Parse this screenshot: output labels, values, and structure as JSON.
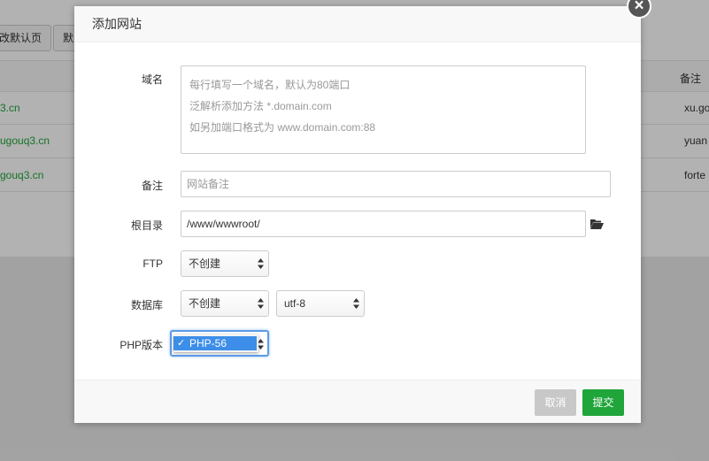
{
  "background": {
    "buttons": [
      "改默认页",
      "默"
    ],
    "column_header": "备注",
    "rows": [
      {
        "domain": "3.cn",
        "note": "xu.go"
      },
      {
        "domain": "ugouq3.cn",
        "note": "yuan"
      },
      {
        "domain": "gouq3.cn",
        "note": "forte"
      }
    ]
  },
  "dialog": {
    "title": "添加网站",
    "close_label": "×",
    "fields": {
      "domain": {
        "label": "域名",
        "placeholder_lines": [
          "每行填写一个域名，默认为80端口",
          "泛解析添加方法 *.domain.com",
          "如另加端口格式为 www.domain.com:88"
        ]
      },
      "note": {
        "label": "备注",
        "placeholder": "网站备注"
      },
      "root": {
        "label": "根目录",
        "value": "/www/wwwroot/"
      },
      "ftp": {
        "label": "FTP",
        "selected": "不创建"
      },
      "database": {
        "label": "数据库",
        "selected": "不创建",
        "charset": "utf-8"
      },
      "php": {
        "label": "PHP版本",
        "selected": "PHP-56"
      }
    },
    "footer": {
      "cancel_label": "取消",
      "submit_label": "提交"
    }
  },
  "colors": {
    "accent": "#20a53a",
    "cancel": "#c8c8c8",
    "focus": "#3d8ee8"
  }
}
